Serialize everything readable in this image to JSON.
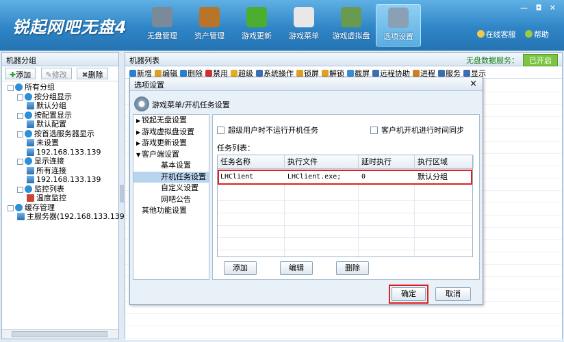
{
  "app": {
    "logo_text": "锐起网吧无盘4"
  },
  "toolbar": {
    "items": [
      {
        "label": "无盘管理",
        "icon": "disk-drive-icon",
        "color": "#7b8a99"
      },
      {
        "label": "资产管理",
        "icon": "briefcase-icon",
        "color": "#b8752a"
      },
      {
        "label": "游戏更新",
        "icon": "refresh-icon",
        "color": "#4cae2e"
      },
      {
        "label": "游戏菜单",
        "icon": "gamepad-icon",
        "color": "#e8e8e8"
      },
      {
        "label": "游戏虚拟盘",
        "icon": "virtual-disk-icon",
        "color": "#6a9a50"
      },
      {
        "label": "选项设置",
        "icon": "gear-icon",
        "color": "#8aa0b4"
      }
    ],
    "active": "选项设置"
  },
  "window_controls": {
    "text": "— ◘ ✕"
  },
  "top_links": {
    "service": "在线客服",
    "help": "帮助"
  },
  "left_panel": {
    "title": "机器分组",
    "buttons": {
      "add": "添加",
      "edit": "修改",
      "delete": "删除"
    },
    "tree": [
      {
        "label": "所有分组",
        "level": 0,
        "icon": "group-icon"
      },
      {
        "label": "按分组显示",
        "level": 1,
        "icon": "group-icon"
      },
      {
        "label": "默认分组",
        "level": 2,
        "icon": "computer-icon"
      },
      {
        "label": "按配置显示",
        "level": 1,
        "icon": "group-icon"
      },
      {
        "label": "默认配置",
        "level": 2,
        "icon": "computer-icon"
      },
      {
        "label": "按首选服务器显示",
        "level": 1,
        "icon": "group-icon"
      },
      {
        "label": "未设置",
        "level": 2,
        "icon": "computer-icon"
      },
      {
        "label": "192.168.133.139",
        "level": 2,
        "icon": "computer-icon"
      },
      {
        "label": "显示连接",
        "level": 1,
        "icon": "group-icon"
      },
      {
        "label": "所有连接",
        "level": 2,
        "icon": "computer-icon"
      },
      {
        "label": "192.168.133.139",
        "level": 2,
        "icon": "computer-icon"
      },
      {
        "label": "监控列表",
        "level": 1,
        "icon": "group-icon"
      },
      {
        "label": "温度监控",
        "level": 2,
        "icon": "thermometer-icon"
      },
      {
        "label": "缓存管理",
        "level": 0,
        "icon": "group-icon"
      },
      {
        "label": "主服务器(192.168.133.139",
        "level": 1,
        "icon": "computer-icon"
      }
    ]
  },
  "right_panel": {
    "title": "机器列表",
    "service_label": "无盘数据服务：",
    "service_status": "已开启",
    "tools": [
      "新增",
      "编辑",
      "删除",
      "禁用",
      "超级",
      "系统操作",
      "锁屏",
      "解锁",
      "截屏",
      "远程协助",
      "进程",
      "服务",
      "显示"
    ]
  },
  "dialog": {
    "title": "选项设置",
    "close": "×",
    "header": "游戏菜单/开机任务设置",
    "nav": [
      {
        "label": "锐起无盘设置",
        "arrow": "▶",
        "sub": false
      },
      {
        "label": "游戏虚拟盘设置",
        "arrow": "▶",
        "sub": false
      },
      {
        "label": "游戏更新设置",
        "arrow": "▶",
        "sub": false
      },
      {
        "label": "客户端设置",
        "arrow": "▼",
        "sub": false
      },
      {
        "label": "基本设置",
        "arrow": "",
        "sub": true
      },
      {
        "label": "开机任务设置",
        "arrow": "",
        "sub": true
      },
      {
        "label": "自定义设置",
        "arrow": "",
        "sub": true
      },
      {
        "label": "网吧公告",
        "arrow": "",
        "sub": true
      },
      {
        "label": "其他功能设置",
        "arrow": "",
        "sub": false
      }
    ],
    "selected_nav": "开机任务设置",
    "option1": "超级用户时不运行开机任务",
    "option2": "客户机开机进行时间同步",
    "list_label": "任务列表：",
    "columns": [
      "任务名称",
      "执行文件",
      "延时执行",
      "执行区域"
    ],
    "rows": [
      [
        "LHClient",
        "LHClient.exe;",
        "0",
        "默认分组"
      ]
    ],
    "buttons": {
      "add": "添加",
      "edit": "编辑",
      "delete": "删除",
      "ok": "确定",
      "cancel": "取消"
    }
  }
}
